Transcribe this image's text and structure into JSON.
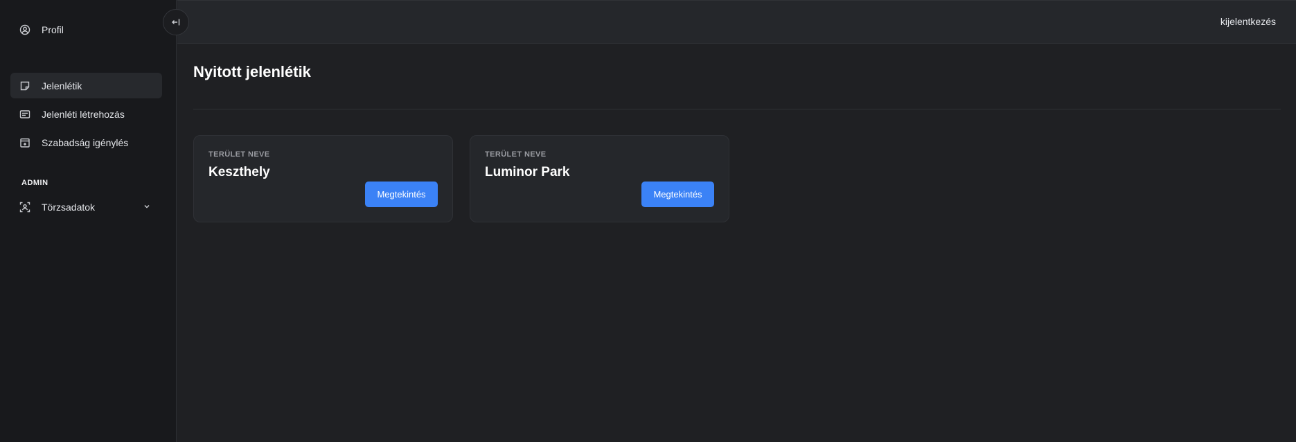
{
  "sidebar": {
    "profile_label": "Profil",
    "items": [
      {
        "label": "Jelenlétik",
        "icon": "sticky-note-icon",
        "active": true
      },
      {
        "label": "Jelenléti létrehozás",
        "icon": "id-card-icon",
        "active": false
      },
      {
        "label": "Szabadság igénylés",
        "icon": "calendar-plus-icon",
        "active": false
      }
    ],
    "section_label": "ADMIN",
    "admin_items": [
      {
        "label": "Törzsadatok",
        "icon": "user-scan-icon"
      }
    ]
  },
  "topbar": {
    "logout_label": "kijelentkezés"
  },
  "main": {
    "title": "Nyitott jelenlétik",
    "cards": [
      {
        "label": "TERÜLET NEVE",
        "name": "Keszthely",
        "button_label": "Megtekintés"
      },
      {
        "label": "TERÜLET NEVE",
        "name": "Luminor Park",
        "button_label": "Megtekintés"
      }
    ]
  },
  "colors": {
    "accent": "#3b82f6",
    "background": "#1f2023",
    "sidebar": "#18191c",
    "card": "#25272b"
  }
}
